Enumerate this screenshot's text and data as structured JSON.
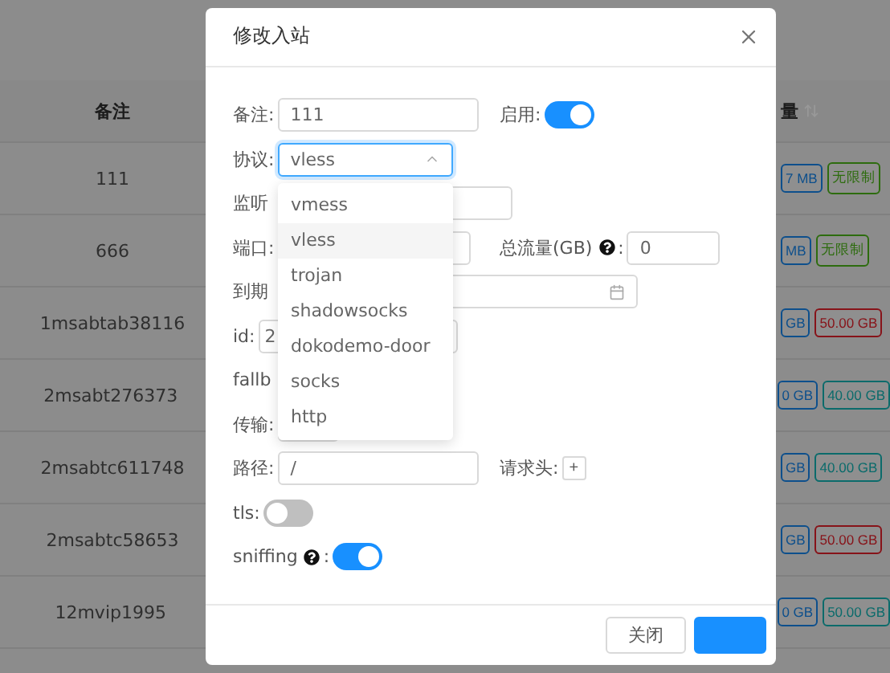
{
  "table": {
    "columns": [
      {
        "label": "备注"
      },
      {
        "label": "量"
      }
    ],
    "rows": [
      {
        "remark": "111",
        "used": "7 MB",
        "total": "无限制",
        "color": "#2d6c0e"
      },
      {
        "remark": "666",
        "used": "MB",
        "total": "无限制",
        "color": "#2d6c0e"
      },
      {
        "remark": "1msabtab38116",
        "used": "GB",
        "total": "50.00 GB",
        "color": "#871319"
      },
      {
        "remark": "2msabt276373",
        "used": "0 GB",
        "total": "40.00 GB",
        "color": "#0b6b6b"
      },
      {
        "remark": "2msabtc611748",
        "used": "GB",
        "total": "40.00 GB",
        "color": "#0b6b6b"
      },
      {
        "remark": "2msabtc58653",
        "used": "GB",
        "total": "50.00 GB",
        "color": "#871319"
      },
      {
        "remark": "12mvip1995",
        "used": "0 GB",
        "total": "50.00 GB",
        "color": "#0b6b6b"
      }
    ]
  },
  "dialog": {
    "title": "修改入站",
    "remark": {
      "label": "备注:",
      "value": "111"
    },
    "enable": {
      "label": "启用:",
      "on": true
    },
    "protocol": {
      "label": "协议:",
      "value": "vless",
      "expanded": true,
      "options": [
        {
          "label": "vmess",
          "selected": false
        },
        {
          "label": "vless",
          "selected": true
        },
        {
          "label": "trojan",
          "selected": false
        },
        {
          "label": "shadowsocks",
          "selected": false
        },
        {
          "label": "dokodemo-door",
          "selected": false
        },
        {
          "label": "socks",
          "selected": false
        },
        {
          "label": "http",
          "selected": false
        }
      ]
    },
    "listen_ip": {
      "label": "监听"
    },
    "port": {
      "label": "端口:"
    },
    "total_traffic": {
      "label": "总流量(GB)",
      "colon": ":",
      "value": "0"
    },
    "expiry": {
      "label": "到期"
    },
    "id": {
      "label": "id:",
      "value": "2"
    },
    "fallbacks": {
      "label": "fallb"
    },
    "transport": {
      "label": "传输:"
    },
    "path": {
      "label": "路径:",
      "value": "/"
    },
    "headers": {
      "label": "请求头:",
      "add": "+"
    },
    "tls": {
      "label": "tls:",
      "on": false
    },
    "sniffing": {
      "label": "sniffing",
      "colon": ":",
      "on": true
    },
    "buttons": [
      {
        "label": "关闭"
      }
    ]
  }
}
